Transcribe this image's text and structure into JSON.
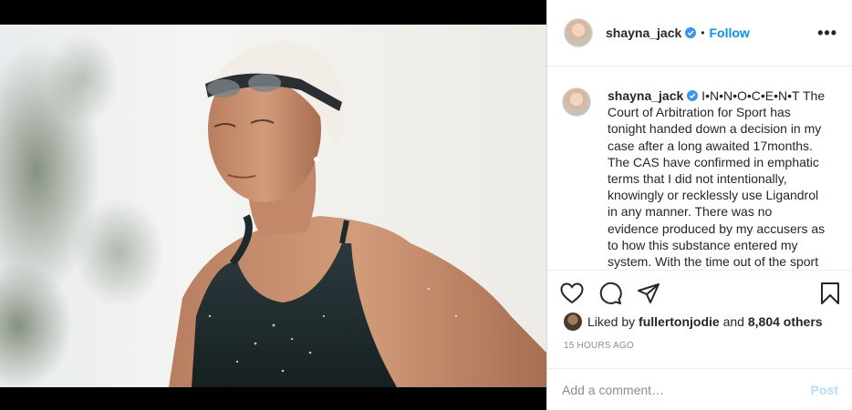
{
  "post": {
    "author": {
      "username": "shayna_jack",
      "verified": true,
      "verified_icon": "verified-badge-icon"
    },
    "header": {
      "separator": "•",
      "follow_label": "Follow",
      "more_icon": "more-options-icon",
      "more_label": "•••"
    },
    "caption": {
      "username": "shayna_jack",
      "text": " I•N•N•O•C•E•N•T The Court of Arbitration for Sport has tonight handed down a decision in my case after a long awaited 17months. The CAS have confirmed in emphatic terms that I did not intentionally, knowingly or recklessly use Ligandrol in any manner.  There was no evidence produced by my accusers as to how this substance entered my system. With the time out of the sport dating"
    },
    "actions": {
      "like_icon": "heart-icon",
      "comment_icon": "comment-icon",
      "share_icon": "share-icon",
      "save_icon": "bookmark-icon"
    },
    "likes": {
      "prefix": "Liked by",
      "user": "fullertonjodie",
      "conjunction": "and",
      "others": "8,804 others"
    },
    "timestamp": "15 HOURS AGO",
    "comment_box": {
      "placeholder": "Add a comment…",
      "post_label": "Post"
    },
    "colors": {
      "accent": "#0095f6",
      "post_disabled": "#b2dffc",
      "verified": "#3897f0"
    }
  }
}
